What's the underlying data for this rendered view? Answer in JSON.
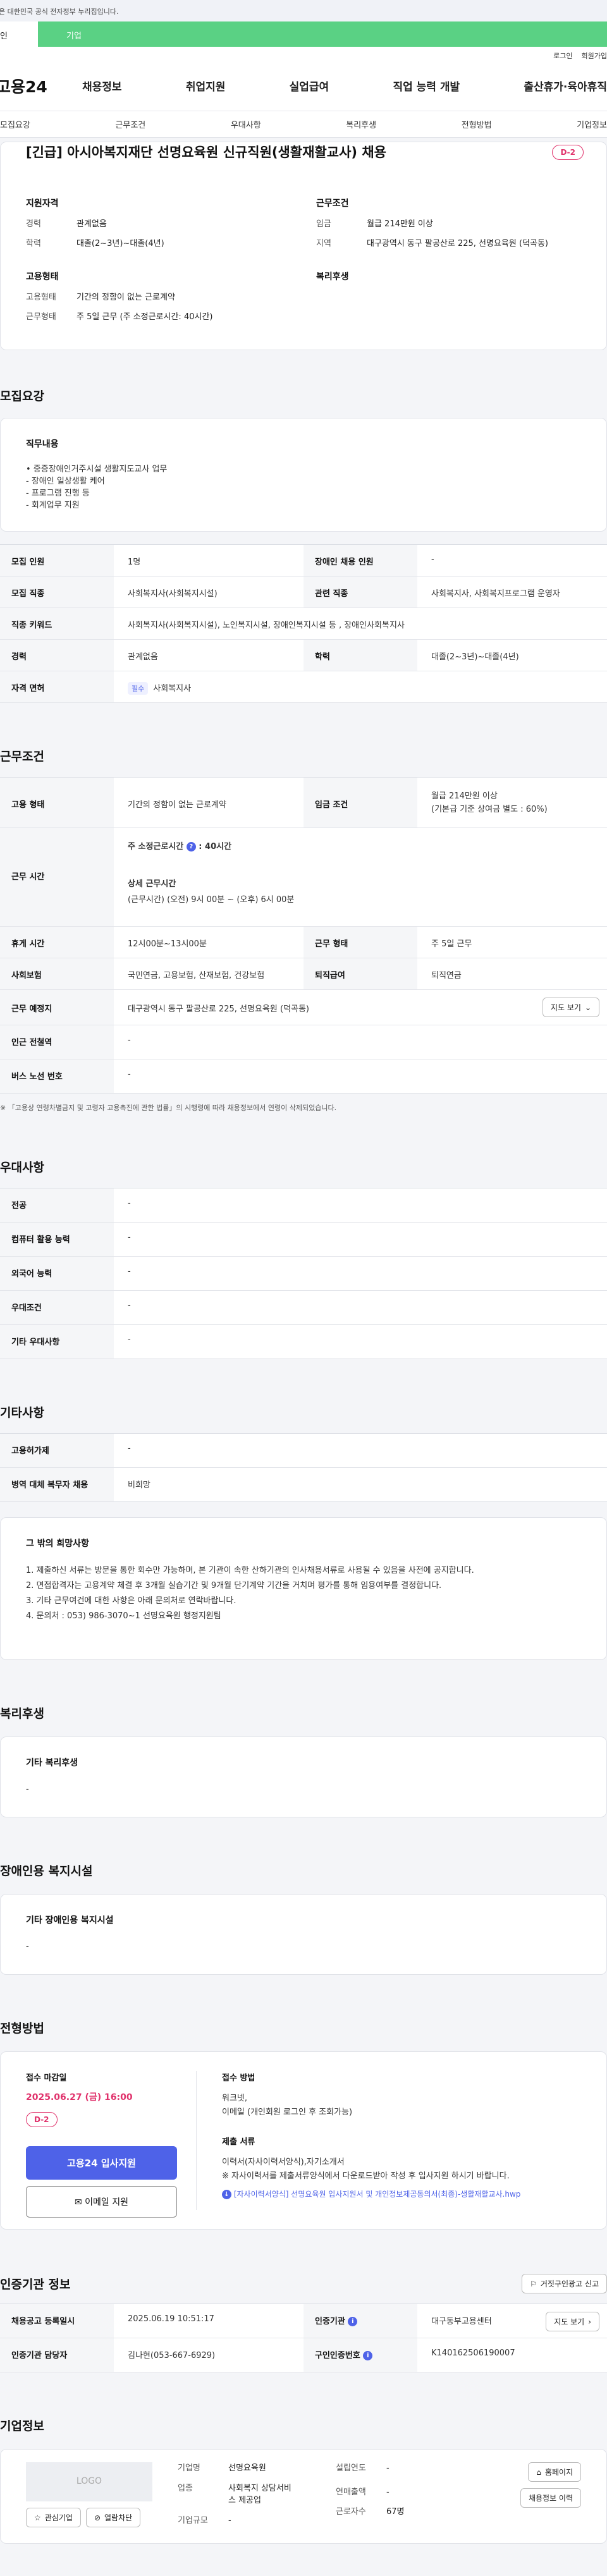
{
  "gov_banner": "이 누리집은 대한민국 공식 전자정부 누리집입니다.",
  "tabs": {
    "personal": "개인",
    "company": "기업"
  },
  "util": {
    "login": "로그인",
    "join": "회원가입"
  },
  "gnb": {
    "logo": "고용24",
    "menu": [
      "채용정보",
      "취업지원",
      "실업급여",
      "직업 능력 개발",
      "출산휴가·육아휴직"
    ]
  },
  "subnav": [
    "모집요강",
    "근무조건",
    "우대사항",
    "복리후생",
    "전형방법",
    "기업정보"
  ],
  "header": {
    "title": "[긴급] 아시아복지재단 선명요육원 신규직원(생활재활교사) 채용",
    "dday": "D-2",
    "qual_title": "지원자격",
    "qual": [
      {
        "k": "경력",
        "v": "관계없음"
      },
      {
        "k": "학력",
        "v": "대졸(2~3년)~대졸(4년)"
      }
    ],
    "work_title": "근무조건",
    "work": [
      {
        "k": "임금",
        "v": "월급 214만원 이상"
      },
      {
        "k": "지역",
        "v": "대구광역시 동구 팔공산로 225, 선명요육원 (덕곡동)"
      }
    ],
    "emp_title": "고용형태",
    "emp": [
      {
        "k": "고용형태",
        "v": "기간의 정함이 없는 근로계약"
      },
      {
        "k": "근무형태",
        "v": "주 5일 근무 (주 소정근로시간: 40시간)"
      }
    ],
    "welfare_title": "복리후생"
  },
  "recruit": {
    "title": "모집요강",
    "duty_title": "직무내용",
    "duties": [
      "• 중증장애인거주시설 생활지도교사 업무",
      "- 장애인 일상생활 케어",
      "- 프로그램 진행 등",
      "- 회계업무 지원"
    ],
    "rows": [
      [
        {
          "k": "모집 인원",
          "v": "1명"
        },
        {
          "k": "장애인 채용 인원",
          "v": "-"
        }
      ],
      [
        {
          "k": "모집 직종",
          "v": "사회복지사(사회복지시설)"
        },
        {
          "k": "관련 직종",
          "v": "사회복지사, 사회복지프로그램 운영자"
        }
      ]
    ],
    "keyword_label": "직종 키워드",
    "keyword_value": "사회복지사(사회복지시설), 노인복지시설, 장애인복지시설 등 , 장애인사회복지사",
    "career_row": [
      {
        "k": "경력",
        "v": "관계없음"
      },
      {
        "k": "학력",
        "v": "대졸(2~3년)~대졸(4년)"
      }
    ],
    "license_label": "자격 면허",
    "license_pill": "필수",
    "license_value": "사회복지사"
  },
  "work": {
    "title": "근무조건",
    "emp_label": "고용 형태",
    "emp_value": "기간의 정함이 없는 근로계약",
    "wage_label": "임금 조건",
    "wage_value": "월급 214만원 이상",
    "wage_sub": "(기본급 기준 상여금 별도 : 60%)",
    "hours_label": "근무 시간",
    "hours_weekly_label": "주 소정근로시간",
    "hours_weekly_value": "40시간",
    "hours_detail_label": "상세 근무시간",
    "hours_detail_value": "(근무시간) (오전) 9시 00분 ~ (오후) 6시 00분",
    "break_label": "휴게 시간",
    "break_value": "12시00분~13시00분",
    "shape_label": "근무 형태",
    "shape_value": "주 5일 근무",
    "insurance_label": "사회보험",
    "insurance_value": "국민연금, 고용보험, 산재보험, 건강보험",
    "retire_label": "퇴직급여",
    "retire_value": "퇴직연금",
    "place_label": "근무 예정지",
    "place_value": "대구광역시 동구 팔공산로 225, 선명요육원 (덕곡동)",
    "map_btn": "지도 보기",
    "subway_label": "인근 전철역",
    "subway_value": "-",
    "bus_label": "버스 노선 번호",
    "bus_value": "-",
    "note": "※ 「고용상 연령차별금지 및 고령자 고용촉진에 관한 법률」의 시행령에 따라 채용정보에서 연령이 삭제되었습니다."
  },
  "pref": {
    "title": "우대사항",
    "rows": [
      {
        "k": "전공",
        "v": "-"
      },
      {
        "k": "컴퓨터 활용 능력",
        "v": "-"
      },
      {
        "k": "외국어 능력",
        "v": "-"
      },
      {
        "k": "우대조건",
        "v": "-"
      },
      {
        "k": "기타 우대사항",
        "v": "-"
      }
    ]
  },
  "etc": {
    "title": "기타사항",
    "rows": [
      {
        "k": "고용허가제",
        "v": "-"
      },
      {
        "k": "병역 대체 복무자 채용",
        "v": "비희망"
      }
    ],
    "other_title": "그 밖의 희망사항",
    "other_lines": [
      "1. 제출하신 서류는 방문을 통한 회수만 가능하며, 본 기관이 속한 산하기관의 인사채용서류로 사용될 수 있음을 사전에 공지합니다.",
      "2. 면접합격자는 고용계약 체결 후 3개월 실습기간 및 9개월 단기계약 기간을 거치며 평가를 통해 임용여부를 결정합니다.",
      "3. 기타 근무여건에 대한 사항은 아래 문의처로 연락바랍니다.",
      "4. 문의처 : 053) 986-3070~1 선명요육원 행정지원팀"
    ]
  },
  "welfare": {
    "title": "복리후생",
    "sub": "기타 복리후생",
    "value": "-"
  },
  "disability": {
    "title": "장애인용 복지시설",
    "sub": "기타 장애인용 복지시설",
    "value": "-"
  },
  "screening": {
    "title": "전형방법",
    "deadline_label": "접수 마감일",
    "deadline": "2025.06.27 (금) 16:00",
    "dday": "D-2",
    "apply_btn": "고용24 입사지원",
    "email_btn": "이메일 지원",
    "method_label": "접수 방법",
    "methods": [
      "워크넷,",
      "이메일 (개인회원 로그인 후 조회가능)"
    ],
    "docs_label": "제출 서류",
    "docs": [
      "이력서(자사이력서양식),자기소개서",
      "※ 자사이력서를 제출서류양식에서 다운로드받아 작성 후 입사지원 하시기 바랍니다."
    ],
    "attachment": "[자사이력서양식] 선명요육원 입사지원서 및 개인정보제공동의서(최종)-생활재활교사.hwp"
  },
  "cert": {
    "title": "인증기관 정보",
    "report_btn": "거짓구인광고 신고",
    "reg_label": "채용공고 등록일시",
    "reg_value": "2025.06.19 10:51:17",
    "agency_label": "인증기관",
    "agency_value": "대구동부고용센터",
    "map_btn": "지도 보기",
    "manager_label": "인증기관 담당자",
    "manager_value": "김나현(053-667-6929)",
    "notice_label": "구인인증번호",
    "notice_value": "K140162506190007"
  },
  "company": {
    "title": "기업정보",
    "logo": "LOGO",
    "fav_btn": "관심기업",
    "block_btn": "열람차단",
    "fields": [
      {
        "k": "기업명",
        "v": "선명요육원"
      },
      {
        "k": "업종",
        "v": "사회복지 상담서비스 제공업"
      },
      {
        "k": "기업규모",
        "v": "-"
      }
    ],
    "fields2": [
      {
        "k": "설립연도",
        "v": "-"
      },
      {
        "k": "연매출액",
        "v": "-"
      },
      {
        "k": "근로자수",
        "v": "67명"
      }
    ],
    "homepage_btn": "홈페이지",
    "jobs_btn": "채용정보 이력"
  }
}
